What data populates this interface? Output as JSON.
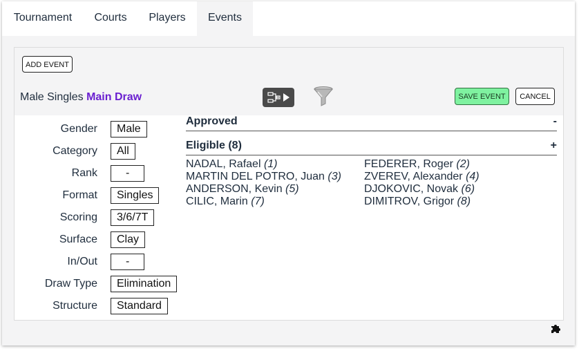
{
  "tabs": [
    {
      "label": "Tournament",
      "active": false
    },
    {
      "label": "Courts",
      "active": false
    },
    {
      "label": "Players",
      "active": false
    },
    {
      "label": "Events",
      "active": true
    }
  ],
  "toolbar": {
    "add_event_label": "ADD EVENT"
  },
  "event": {
    "title_prefix": "Male Singles",
    "title_draw": "Main Draw",
    "draw_icon": "draw-bracket-play-icon",
    "filter_icon": "filter-funnel-icon",
    "save_label": "SAVE EVENT",
    "cancel_label": "CANCEL"
  },
  "fields": [
    {
      "label": "Gender",
      "value": "Male"
    },
    {
      "label": "Category",
      "value": "All"
    },
    {
      "label": "Rank",
      "value": "-"
    },
    {
      "label": "Format",
      "value": "Singles"
    },
    {
      "label": "Scoring",
      "value": "3/6/7T"
    },
    {
      "label": "Surface",
      "value": "Clay"
    },
    {
      "label": "In/Out",
      "value": "-"
    },
    {
      "label": "Draw Type",
      "value": "Elimination"
    },
    {
      "label": "Structure",
      "value": "Standard"
    }
  ],
  "approved": {
    "title": "Approved",
    "toggle": "-"
  },
  "eligible": {
    "title": "Eligible (8)",
    "toggle": "+",
    "players": [
      {
        "name": "NADAL, Rafael",
        "seed": "(1)"
      },
      {
        "name": "FEDERER, Roger",
        "seed": "(2)"
      },
      {
        "name": "MARTIN DEL POTRO, Juan",
        "seed": "(3)"
      },
      {
        "name": "ZVEREV, Alexander",
        "seed": "(4)"
      },
      {
        "name": "ANDERSON, Kevin",
        "seed": "(5)"
      },
      {
        "name": "DJOKOVIC, Novak",
        "seed": "(6)"
      },
      {
        "name": "CILIC, Marin",
        "seed": "(7)"
      },
      {
        "name": "DIMITROV, Grigor",
        "seed": "(8)"
      }
    ]
  },
  "footer": {
    "corner_icon": "puzzle-piece-icon"
  },
  "colors": {
    "accent_draw": "#6a1fd0",
    "save_green": "#7ff2a0",
    "background": "#f4f4f5"
  }
}
